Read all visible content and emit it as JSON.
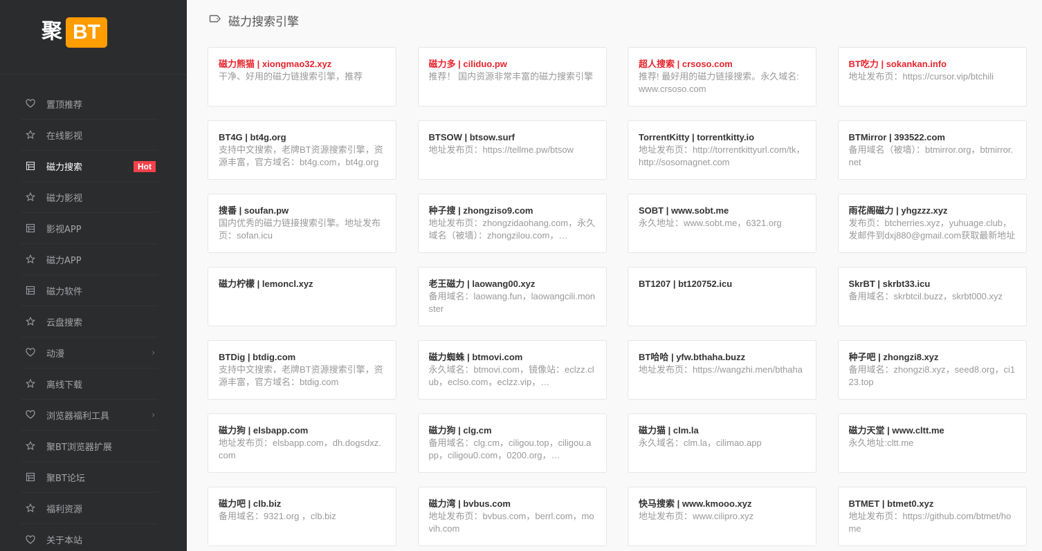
{
  "logo": {
    "text": "聚",
    "badge": "BT",
    "badge_color": "#ff9c00"
  },
  "nav": {
    "items": [
      {
        "label": "置顶推荐",
        "icon": "heart-icon",
        "active": false
      },
      {
        "label": "在线影视",
        "icon": "star-icon",
        "active": false
      },
      {
        "label": "磁力搜索",
        "icon": "grid-icon",
        "active": true,
        "badge": "Hot"
      },
      {
        "label": "磁力影视",
        "icon": "star-icon",
        "active": false
      },
      {
        "label": "影视APP",
        "icon": "grid-icon",
        "active": false
      },
      {
        "label": "磁力APP",
        "icon": "star-icon",
        "active": false
      },
      {
        "label": "磁力软件",
        "icon": "grid-icon",
        "active": false
      },
      {
        "label": "云盘搜索",
        "icon": "star-icon",
        "active": false
      },
      {
        "label": "动漫",
        "icon": "heart-icon",
        "active": false,
        "arrow": "›"
      },
      {
        "label": "离线下载",
        "icon": "star-icon",
        "active": false
      },
      {
        "label": "浏览器福利工具",
        "icon": "heart-icon",
        "active": false,
        "arrow": "›"
      },
      {
        "label": "聚BT浏览器扩展",
        "icon": "star-icon",
        "active": false
      },
      {
        "label": "聚BT论坛",
        "icon": "grid-icon",
        "active": false
      },
      {
        "label": "福利资源",
        "icon": "star-icon",
        "active": false
      },
      {
        "label": "关于本站",
        "icon": "heart-icon",
        "active": false
      }
    ]
  },
  "header": {
    "title": "磁力搜索引擎",
    "icon": "tag-icon"
  },
  "cards": [
    {
      "title": "磁力熊猫 | xiongmao32.xyz",
      "desc": "干净、好用的磁力链搜索引擎，推荐",
      "highlight": true
    },
    {
      "title": "磁力多 | ciliduo.pw",
      "desc": "推荐！ 国内资源非常丰富的磁力搜索引擎",
      "highlight": true
    },
    {
      "title": "超人搜索 | crsoso.com",
      "desc": "推荐! 最好用的磁力链接搜索。永久域名: www.crsoso.com",
      "highlight": true
    },
    {
      "title": "BT吃力 | sokankan.info",
      "desc": "地址发布页：https://cursor.vip/btchili",
      "highlight": true
    },
    {
      "title": "BT4G | bt4g.org",
      "desc": "支持中文搜索，老牌BT资源搜索引擎，资源丰富，官方域名：bt4g.com，bt4g.org",
      "highlight": false
    },
    {
      "title": "BTSOW | btsow.surf",
      "desc": "地址发布页：https://tellme.pw/btsow",
      "highlight": false
    },
    {
      "title": "TorrentKitty | torrentkitty.io",
      "desc": "地址发布页：http://torrentkittyurl.com/tk，http://sosomagnet.com",
      "highlight": false
    },
    {
      "title": "BTMirror | 393522.com",
      "desc": "备用域名（被墙）：btmirror.org，btmirror.net",
      "highlight": false
    },
    {
      "title": "搜番 | soufan.pw",
      "desc": "国内优秀的磁力链接搜索引擎。地址发布页：sofan.icu",
      "highlight": false
    },
    {
      "title": "种子搜 | zhongziso9.com",
      "desc": "地址发布页：zhongzidaohang.com，永久域名（被墙）：zhongzilou.com，…",
      "highlight": false
    },
    {
      "title": "SOBT | www.sobt.me",
      "desc": "永久地址：www.sobt.me，6321.org",
      "highlight": false
    },
    {
      "title": "雨花阁磁力 | yhgzzz.xyz",
      "desc": "发布页：btcherries.xyz，yuhuage.club，发邮件到dxj880@gmail.com获取最新地址",
      "highlight": false
    },
    {
      "title": "磁力柠檬 | lemoncl.xyz",
      "desc": "",
      "highlight": false
    },
    {
      "title": "老王磁力 | laowang00.xyz",
      "desc": "备用域名：laowang.fun，laowangcili.monster",
      "highlight": false
    },
    {
      "title": "BT1207 | bt120752.icu",
      "desc": "",
      "highlight": false
    },
    {
      "title": "SkrBT | skrbt33.icu",
      "desc": "备用域名：skrbtcil.buzz，skrbt000.xyz",
      "highlight": false
    },
    {
      "title": "BTDig | btdig.com",
      "desc": "支持中文搜索，老牌BT资源搜索引擎，资源丰富，官方域名：btdig.com",
      "highlight": false
    },
    {
      "title": "磁力蜘蛛 | btmovi.com",
      "desc": "永久域名：btmovi.com，镜像站：eclzz.club，eclso.com，eclzz.vip，…",
      "highlight": false
    },
    {
      "title": "BT哈哈 | yfw.bthaha.buzz",
      "desc": "地址发布页：https://wangzhi.men/bthaha",
      "highlight": false
    },
    {
      "title": "种子吧 | zhongzi8.xyz",
      "desc": "备用域名：zhongzi8.xyz，seed8.org，ci123.top",
      "highlight": false
    },
    {
      "title": "磁力狗 | elsbapp.com",
      "desc": "地址发布页：elsbapp.com，dh.dogsdxz.com",
      "highlight": false
    },
    {
      "title": "磁力狗 | clg.cm",
      "desc": "备用域名：clg.cm，ciligou.top，ciligou.app，ciligou0.com，0200.org，…",
      "highlight": false
    },
    {
      "title": "磁力猫 | clm.la",
      "desc": "永久域名：clm.la，cilimao.app",
      "highlight": false
    },
    {
      "title": "磁力天堂 | www.cltt.me",
      "desc": "永久地址:cltt.me",
      "highlight": false
    },
    {
      "title": "磁力吧 | clb.biz",
      "desc": "备用域名：9321.org ，clb.biz",
      "highlight": false
    },
    {
      "title": "磁力湾 | bvbus.com",
      "desc": "地址发布页：bvbus.com，berrl.com，movih.com",
      "highlight": false
    },
    {
      "title": "快马搜索 | www.kmooo.xyz",
      "desc": "地址发布页：www.cilipro.xyz",
      "highlight": false
    },
    {
      "title": "BTMET | btmet0.xyz",
      "desc": "地址发布页：https://github.com/btmet/home",
      "highlight": false
    }
  ],
  "colors": {
    "sidebar_bg": "#2b2c2e",
    "highlight_title": "#e5252d",
    "hot_badge": "#f5414b"
  }
}
